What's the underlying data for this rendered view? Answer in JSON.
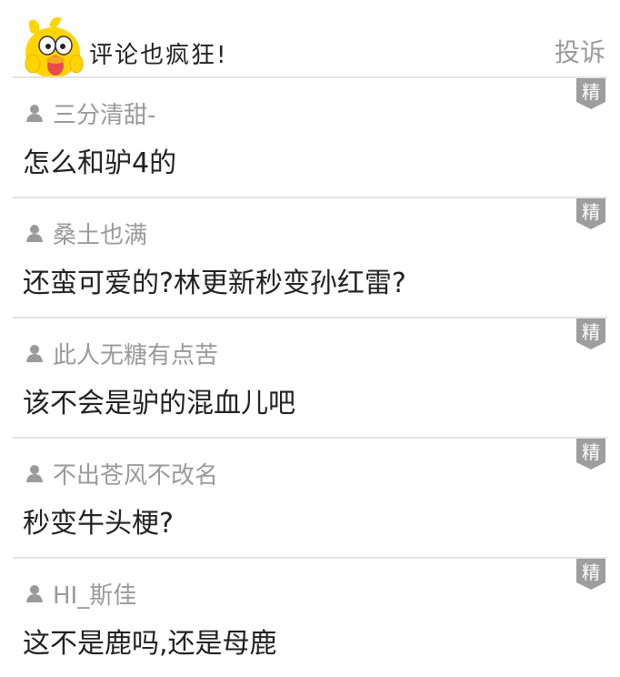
{
  "header": {
    "title": "评论也疯狂!",
    "report_label": "投诉"
  },
  "badge_label": "精",
  "colors": {
    "divider": "#e4e4e4",
    "badge": "#9e9e9e",
    "username": "#9a9a9a",
    "text": "#222222"
  },
  "icons": {
    "mascot": "yellow-duck-mascot-icon",
    "user": "user-icon",
    "badge": "featured-badge-icon"
  },
  "comments": [
    {
      "user": "三分清甜-",
      "text": "怎么和驴4的"
    },
    {
      "user": "桑土也满",
      "text": "还蛮可爱的?林更新秒变孙红雷?"
    },
    {
      "user": "此人无糖有点苦",
      "text": "该不会是驴的混血儿吧"
    },
    {
      "user": "不出苍风不改名",
      "text": "秒变牛头梗?"
    },
    {
      "user": "HI_斯佳",
      "text": "这不是鹿吗,还是母鹿"
    }
  ]
}
